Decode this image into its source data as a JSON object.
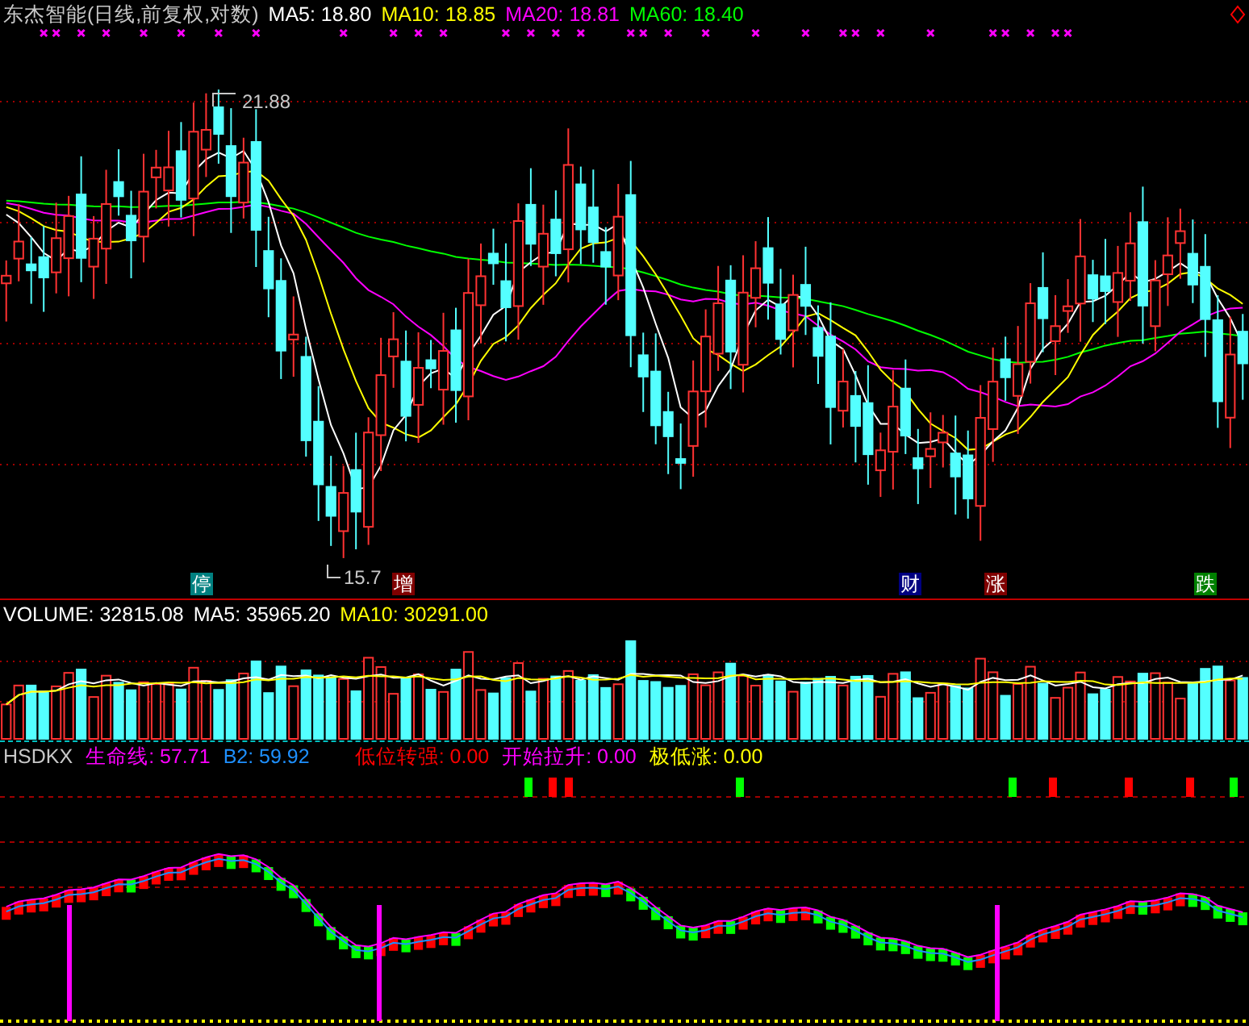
{
  "price_pane": {
    "title": "东杰智能(日线,前复权,对数)",
    "indicators": [
      {
        "label": "MA5: 18.80",
        "color": "#ffffff"
      },
      {
        "label": "MA10: 18.85",
        "color": "#ffff00"
      },
      {
        "label": "MA20: 18.81",
        "color": "#ff00ff"
      },
      {
        "label": "MA60: 18.40",
        "color": "#00ff00"
      }
    ],
    "price_labels": [
      {
        "kind": "high",
        "text": "21.88"
      },
      {
        "kind": "low",
        "text": "15.7"
      }
    ],
    "event_markers": [
      {
        "text": "停",
        "color": "#008080"
      },
      {
        "text": "增",
        "color": "#800000"
      },
      {
        "text": "财",
        "color": "#000080"
      },
      {
        "text": "涨",
        "color": "#800000"
      },
      {
        "text": "跌",
        "color": "#008000"
      }
    ]
  },
  "volume_pane": {
    "indicators": [
      {
        "label": "VOLUME: 32815.08",
        "color": "#ffffff"
      },
      {
        "label": "MA5: 35965.20",
        "color": "#ffffff"
      },
      {
        "label": "MA10: 30291.00",
        "color": "#ffff00"
      }
    ]
  },
  "hsdkx_pane": {
    "name": "HSDKX",
    "indicators": [
      {
        "label": "生命线: 57.71",
        "color": "#ff00ff"
      },
      {
        "label": "B2: 59.92",
        "color": "#1e90ff"
      },
      {
        "label": "低位转强: 0.00",
        "color": "#ff0000"
      },
      {
        "label": "开始拉升: 0.00",
        "color": "#ff00ff"
      },
      {
        "label": "极低涨: 0.00",
        "color": "#ffff00"
      }
    ]
  }
}
